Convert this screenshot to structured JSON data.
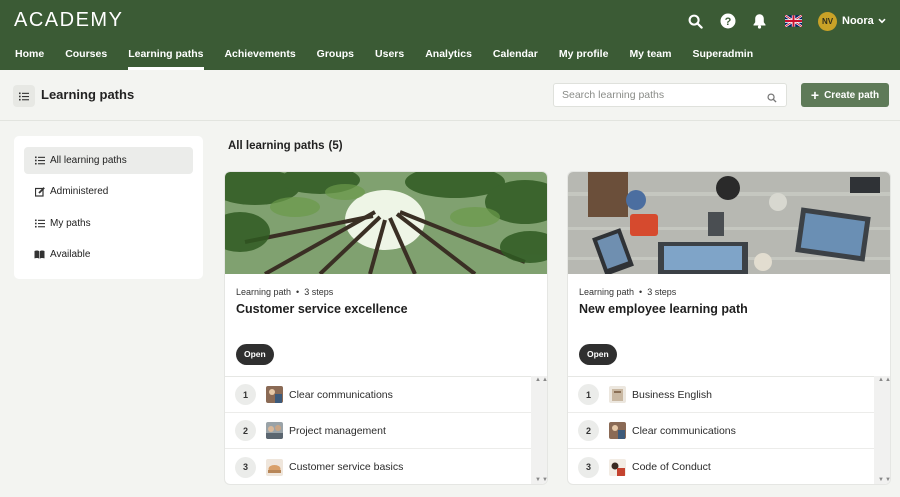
{
  "app": {
    "logo": "ACADEMY"
  },
  "header": {
    "user": {
      "initials": "NV",
      "name": "Noora"
    }
  },
  "nav": {
    "items": [
      {
        "label": "Home"
      },
      {
        "label": "Courses"
      },
      {
        "label": "Learning paths",
        "active": true
      },
      {
        "label": "Achievements"
      },
      {
        "label": "Groups"
      },
      {
        "label": "Users"
      },
      {
        "label": "Analytics"
      },
      {
        "label": "Calendar"
      },
      {
        "label": "My profile"
      },
      {
        "label": "My team"
      },
      {
        "label": "Superadmin"
      }
    ]
  },
  "page": {
    "title": "Learning paths",
    "search_placeholder": "Search learning paths",
    "create_label": "Create path"
  },
  "sidebar": {
    "items": [
      {
        "label": "All learning paths",
        "icon": "list-icon",
        "active": true
      },
      {
        "label": "Administered",
        "icon": "edit-icon"
      },
      {
        "label": "My paths",
        "icon": "list-icon"
      },
      {
        "label": "Available",
        "icon": "book-icon"
      }
    ]
  },
  "section": {
    "title": "All learning paths",
    "count": "(5)"
  },
  "cards": [
    {
      "type_label": "Learning path",
      "steps_label": "3 steps",
      "title": "Customer service excellence",
      "badge": "Open",
      "steps": [
        {
          "num": "1",
          "name": "Clear communications"
        },
        {
          "num": "2",
          "name": "Project management"
        },
        {
          "num": "3",
          "name": "Customer service basics"
        }
      ]
    },
    {
      "type_label": "Learning path",
      "steps_label": "3 steps",
      "title": "New employee learning path",
      "badge": "Open",
      "steps": [
        {
          "num": "1",
          "name": "Business English"
        },
        {
          "num": "2",
          "name": "Clear communications"
        },
        {
          "num": "3",
          "name": "Code of Conduct"
        }
      ]
    }
  ],
  "colors": {
    "header_bg": "#3b5b35",
    "button_bg": "#5e7a58",
    "badge_bg": "#2f2f2f"
  }
}
